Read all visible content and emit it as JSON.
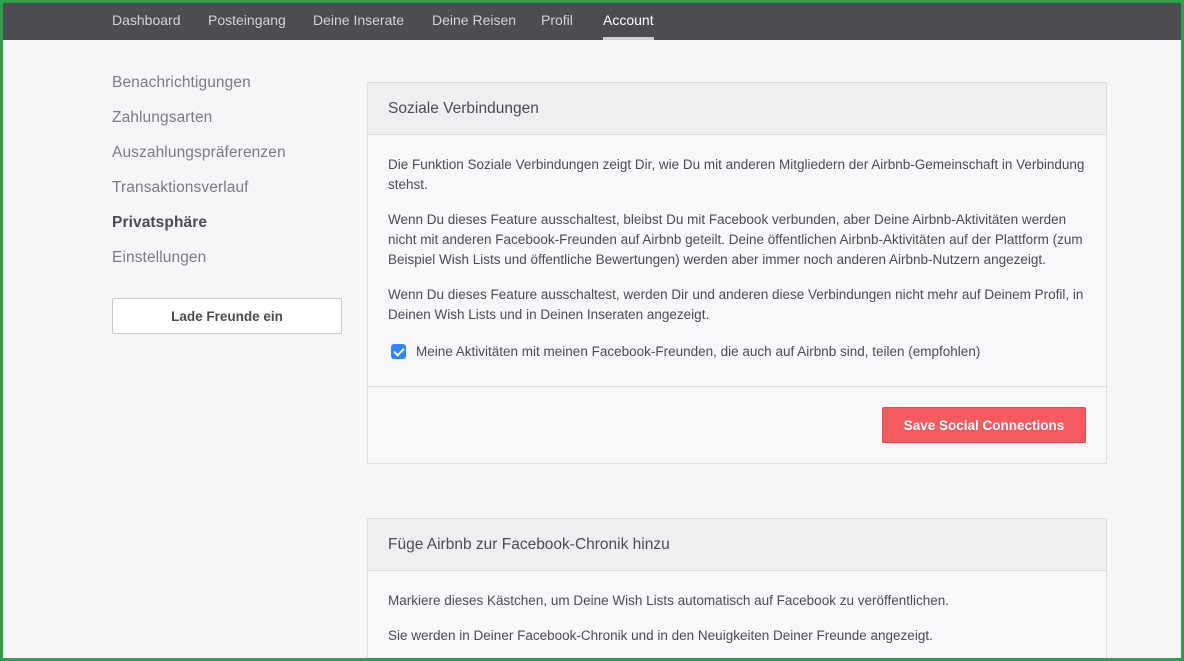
{
  "nav": {
    "items": [
      {
        "label": "Dashboard"
      },
      {
        "label": "Posteingang"
      },
      {
        "label": "Deine Inserate"
      },
      {
        "label": "Deine Reisen"
      },
      {
        "label": "Profil"
      },
      {
        "label": "Account",
        "active": true
      }
    ]
  },
  "sidebar": {
    "items": [
      {
        "label": "Benachrichtigungen"
      },
      {
        "label": "Zahlungsarten"
      },
      {
        "label": "Auszahlungspräferenzen"
      },
      {
        "label": "Transaktionsverlauf"
      },
      {
        "label": "Privatsphäre",
        "active": true
      },
      {
        "label": "Einstellungen"
      }
    ],
    "invite_button": "Lade Freunde ein"
  },
  "social": {
    "title": "Soziale Verbindungen",
    "paragraphs": [
      "Die Funktion Soziale Verbindungen zeigt Dir, wie Du mit anderen Mitgliedern der Airbnb-Gemeinschaft in Verbindung stehst.",
      "Wenn Du dieses Feature ausschaltest, bleibst Du mit Facebook verbunden, aber Deine Airbnb-Aktivitäten werden nicht mit anderen Facebook-Freunden auf Airbnb geteilt. Deine öffentlichen Airbnb-Aktivitäten auf der Plattform (zum Beispiel Wish Lists und öffentliche Bewertungen) werden aber immer noch anderen Airbnb-Nutzern angezeigt.",
      "Wenn Du dieses Feature ausschaltest, werden Dir und anderen diese Verbindungen nicht mehr auf Deinem Profil, in Deinen Wish Lists und in Deinen Inseraten angezeigt."
    ],
    "checkbox_label": "Meine Aktivitäten mit meinen Facebook-Freunden, die auch auf Airbnb sind, teilen (empfohlen)",
    "checkbox_checked": true,
    "save_button": "Save Social Connections"
  },
  "timeline": {
    "title": "Füge Airbnb zur Facebook-Chronik hinzu",
    "paragraphs": [
      "Markiere dieses Kästchen, um Deine Wish Lists automatisch auf Facebook zu veröffentlichen.",
      "Sie werden in Deiner Facebook-Chronik und in den Neuigkeiten Deiner Freunde angezeigt."
    ]
  },
  "colors": {
    "nav_bg": "#4b4d52",
    "accent_red": "#f55a5f",
    "checkbox_blue": "#2f86f6",
    "frame_green": "#2aa048"
  }
}
